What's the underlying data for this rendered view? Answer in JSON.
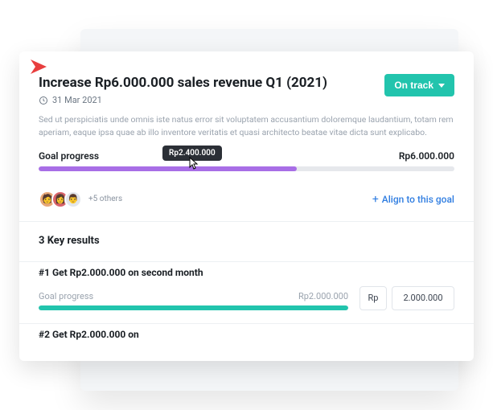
{
  "goal": {
    "title": "Increase Rp6.000.000 sales revenue Q1 (2021)",
    "due_date": "31 Mar 2021",
    "status_label": "On track",
    "description": "Sed ut perspiciatis unde omnis iste natus error sit voluptatem accusantium doloremque laudantium, totam rem aperiam, eaque ipsa quae ab illo inventore veritatis et quasi architecto beatae vitae dicta sunt explicabo.",
    "progress_label": "Goal progress",
    "progress_target": "Rp6.000.000",
    "progress_tooltip": "Rp2.400.000",
    "others_label": "+5 others",
    "align_label": "Align to this goal"
  },
  "key_results": {
    "header": "3 Key results",
    "items": [
      {
        "title": "#1 Get Rp2.000.000 on second month",
        "progress_label": "Goal progress",
        "progress_value": "Rp2.000.000",
        "unit": "Rp",
        "input_value": "2.000.000"
      },
      {
        "title": "#2 Get Rp2.000.000 on"
      }
    ]
  }
}
